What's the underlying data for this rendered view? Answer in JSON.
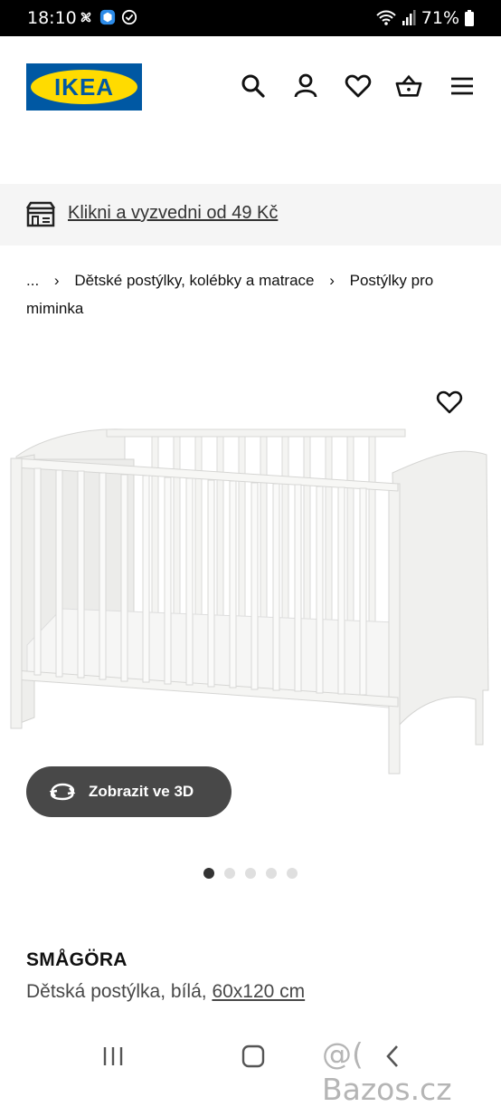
{
  "status_bar": {
    "time": "18:10",
    "battery": "71%",
    "icons": [
      "fan-icon",
      "vpn-icon",
      "sync-icon",
      "wifi-icon",
      "signal-icon",
      "battery-icon"
    ]
  },
  "header": {
    "logo_text": "IKEA",
    "brand_colors": {
      "blue": "#0058a3",
      "yellow": "#ffdb00"
    },
    "icons": [
      "search-icon",
      "account-icon",
      "heart-icon",
      "basket-icon",
      "menu-icon"
    ]
  },
  "pickup": {
    "label": "Klikni a vyzvedni od 49 Kč",
    "icon": "store-icon"
  },
  "breadcrumb": {
    "items": [
      "...",
      "Dětské postýlky, kolébky a matrace",
      "Postýlky pro miminka"
    ]
  },
  "product": {
    "view_3d_label": "Zobrazit ve 3D",
    "image_count": 5,
    "active_image": 1,
    "name": "SMÅGÖRA",
    "description": "Dětská postýlka, bílá,",
    "size": "60x120 cm"
  },
  "watermark": "@( Bazos.cz",
  "navbar": {
    "icons": [
      "recent-apps-icon",
      "home-icon",
      "back-icon"
    ]
  }
}
